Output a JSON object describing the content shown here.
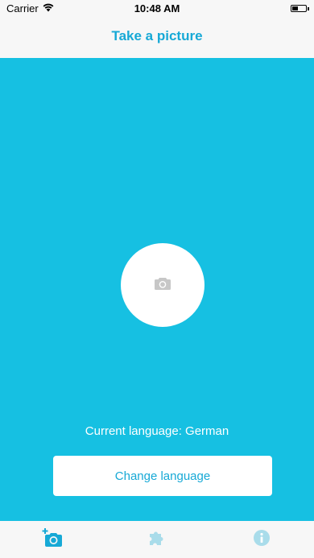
{
  "status_bar": {
    "carrier": "Carrier",
    "time": "10:48 AM",
    "wifi_icon": "wifi-icon",
    "battery_icon": "battery-icon"
  },
  "nav": {
    "title": "Take a picture"
  },
  "main": {
    "camera_icon": "camera-icon",
    "current_language": "Current language: German",
    "change_language_label": "Change language"
  },
  "tabs": [
    {
      "name": "take-picture",
      "icon": "add-photo-icon",
      "active": true
    },
    {
      "name": "puzzle",
      "icon": "puzzle-icon",
      "active": false
    },
    {
      "name": "info",
      "icon": "info-icon",
      "active": false
    }
  ],
  "colors": {
    "accent": "#17a9d6",
    "main_background": "#16c0e2",
    "inactive_icon": "#a9dcea",
    "camera_icon": "#c7c7c7"
  }
}
